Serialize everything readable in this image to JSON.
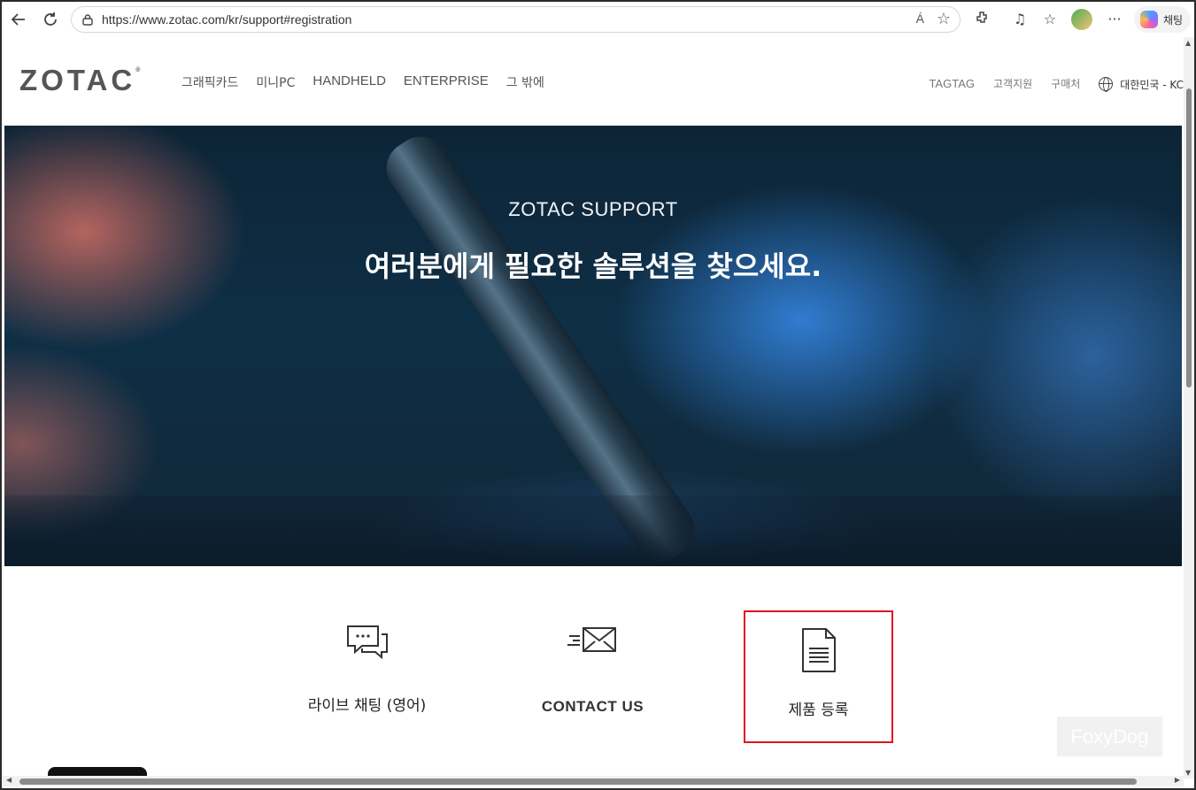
{
  "browser": {
    "url": "https://www.zotac.com/kr/support#registration",
    "read_aloud": "Á",
    "chat_button": "채팅",
    "icons": [
      "back-icon",
      "refresh-icon",
      "lock-icon",
      "read-aloud-icon",
      "favorite-star-icon",
      "extensions-icon",
      "music-icon",
      "favorites-icon",
      "profile-avatar",
      "more-icon",
      "copilot-icon"
    ]
  },
  "header": {
    "logo": "ZOTAC",
    "logo_mark": "®",
    "nav": [
      "그래픽카드",
      "미니PC",
      "HANDHELD",
      "ENTERPRISE",
      "그 밖에"
    ],
    "util": [
      "TAGTAG",
      "고객지원",
      "구매처"
    ],
    "language": "대한민국 - KC"
  },
  "hero": {
    "subtitle": "ZOTAC SUPPORT",
    "title": "여러분에게 필요한 솔루션을 찾으세요."
  },
  "options": {
    "live_chat": "라이브 채팅 (영어)",
    "contact_us": "CONTACT US",
    "registration": "제품 등록"
  },
  "watermark": "FoxyDog",
  "colors": {
    "highlight_border": "#e0141e",
    "logo": "#555555"
  }
}
